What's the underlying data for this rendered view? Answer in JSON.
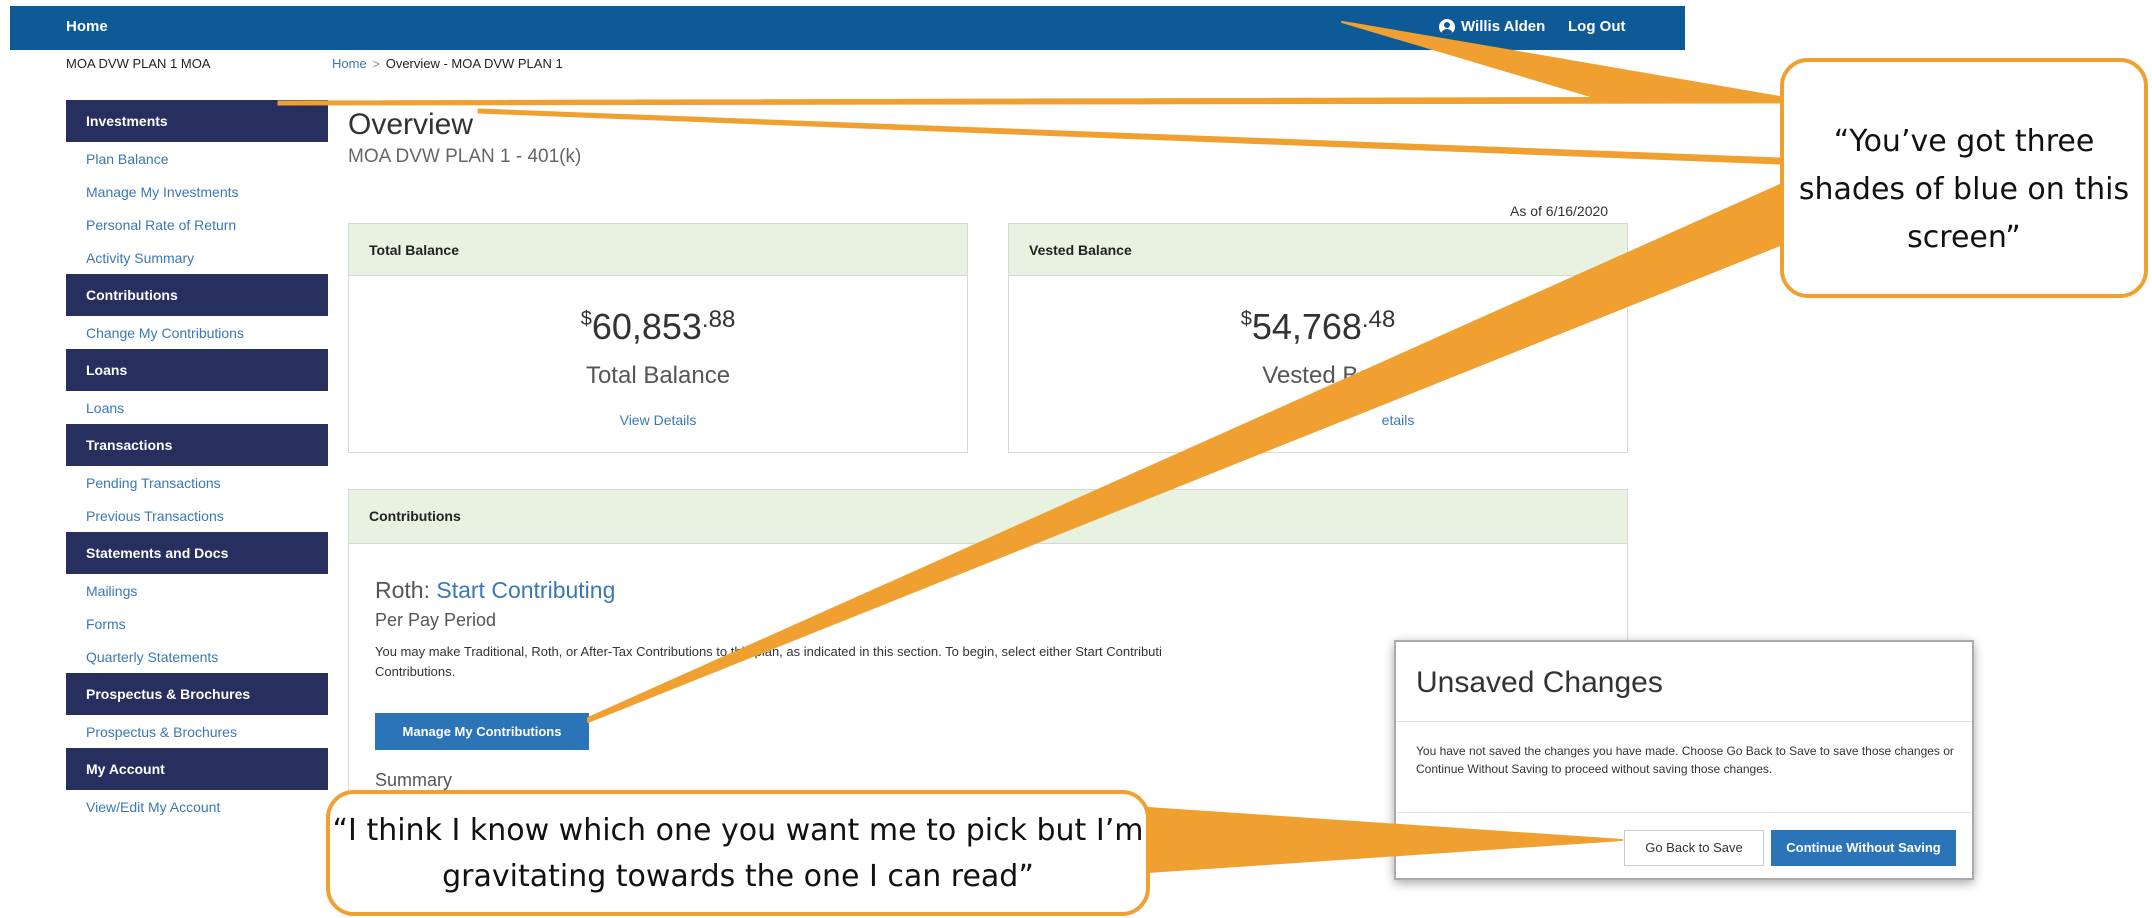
{
  "header": {
    "home_label": "Home",
    "user_name": "Willis Alden",
    "logout_label": "Log Out",
    "bar_color": "#0e5a96"
  },
  "plan_name": "MOA DVW PLAN 1 MOA",
  "breadcrumb": {
    "home": "Home",
    "separator": ">",
    "current": "Overview - MOA DVW PLAN 1"
  },
  "sidebar": {
    "section_color": "#262f5e",
    "sections": [
      {
        "label": "Investments",
        "items": [
          "Plan Balance",
          "Manage My Investments",
          "Personal Rate of Return",
          "Activity Summary"
        ]
      },
      {
        "label": "Contributions",
        "items": [
          "Change My Contributions"
        ]
      },
      {
        "label": "Loans",
        "items": [
          "Loans"
        ]
      },
      {
        "label": "Transactions",
        "items": [
          "Pending Transactions",
          "Previous Transactions"
        ]
      },
      {
        "label": "Statements and Docs",
        "items": [
          "Mailings",
          "Forms",
          "Quarterly Statements"
        ]
      },
      {
        "label": "Prospectus & Brochures",
        "items": [
          "Prospectus & Brochures"
        ]
      },
      {
        "label": "My Account",
        "items": [
          "View/Edit My Account"
        ]
      }
    ]
  },
  "main": {
    "title": "Overview",
    "subtitle": "MOA DVW PLAN 1 - 401(k)",
    "as_of": "As of 6/16/2020",
    "total_balance": {
      "header": "Total Balance",
      "currency": "$",
      "dollars": "60,853",
      "cents": ".88",
      "label": "Total Balance",
      "link": "View Details"
    },
    "vested_balance": {
      "header": "Vested Balance",
      "currency": "$",
      "dollars": "54,768",
      "cents": ".48",
      "label": "Vested Balan",
      "link": "etails"
    },
    "contributions": {
      "header": "Contributions",
      "roth_prefix": "Roth:",
      "roth_link": "Start Contributing",
      "per_pay": "Per Pay Period",
      "description": "You may make Traditional, Roth, or After-Tax Contributions to this plan, as indicated in this section. To begin, select either Start Contributi",
      "description_line2": "Contributions.",
      "manage_button": "Manage My Contributions",
      "summary": "Summary"
    }
  },
  "modal": {
    "title": "Unsaved Changes",
    "body": "You have not saved the changes you have made. Choose Go Back to Save to save those changes or Continue Without Saving to proceed without saving those changes.",
    "back_button": "Go Back to Save",
    "continue_button": "Continue Without Saving"
  },
  "callouts": {
    "top_right": "“You’ve got three shades of blue on this screen”",
    "bottom": "“I think I know which one you want me to pick but I’m gravitating towards the one I can read”",
    "color": "#f0a030"
  }
}
